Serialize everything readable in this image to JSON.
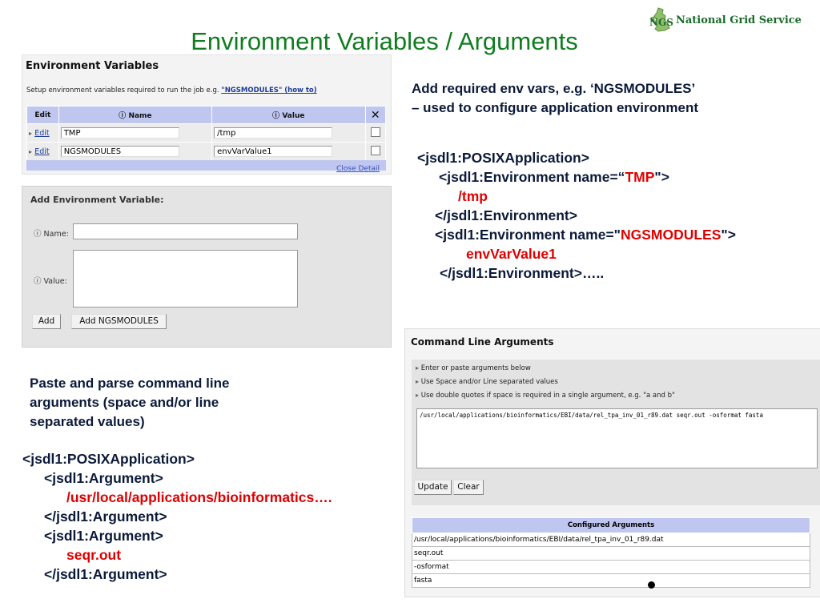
{
  "slide": {
    "title": "Environment Variables / Arguments",
    "logo_text": "National Grid Service",
    "logo_mark": "NGS"
  },
  "env_panel": {
    "heading": "Environment Variables",
    "description": "Setup environment variables required to run the job e.g.",
    "howto_link": "\"NGSMODULES\" (how to)",
    "columns": [
      "Edit",
      "Name",
      "Value"
    ],
    "rows": [
      {
        "edit": "Edit",
        "name": "TMP",
        "value": "/tmp"
      },
      {
        "edit": "Edit",
        "name": "NGSMODULES",
        "value": "envVarValue1"
      }
    ],
    "close_link": "Close Detail"
  },
  "add_panel": {
    "heading": "Add Environment Variable:",
    "name_label": "Name:",
    "value_label": "Value:",
    "add_button": "Add",
    "add_ngsmodules_button": "Add NGSMODULES"
  },
  "env_note": {
    "line1": "Add required env vars, e.g. ‘NGSMODULES’",
    "line2": "– used to configure application environment"
  },
  "env_code": {
    "l1": "<jsdl1:POSIXApplication>",
    "l2a": "<jsdl1:Environment name=“",
    "l2b": "TMP",
    "l2c": "\">",
    "l3": "/tmp",
    "l4": "</jsdl1:Environment>",
    "l5a": "<jsdl1:Environment name=\"",
    "l5b": "NGSMODULES",
    "l5c": "\">",
    "l6": "envVarValue1",
    "l7": "</jsdl1:Environment>….."
  },
  "cmd_panel": {
    "heading": "Command Line Arguments",
    "bullets": [
      "Enter or paste arguments below",
      "Use Space and/or Line separated values",
      "Use double quotes if space is required in a single argument, e.g. \"a and b\""
    ],
    "args_value": "/usr/local/applications/bioinformatics/EBI/data/rel_tpa_inv_01_r89.dat seqr.out -osformat fasta",
    "update_button": "Update",
    "clear_button": "Clear",
    "configured_header": "Configured Arguments",
    "configured": [
      "/usr/local/applications/bioinformatics/EBI/data/rel_tpa_inv_01_r89.dat",
      "seqr.out",
      "-osformat",
      "fasta"
    ]
  },
  "args_note": {
    "line1": "Paste and parse command line",
    "line2": "arguments (space and/or line",
    "line3": "separated values)"
  },
  "args_code": {
    "l1": "<jsdl1:POSIXApplication>",
    "l2": "<jsdl1:Argument>",
    "l3": "/usr/local/applications/bioinformatics….",
    "l4": "</jsdl1:Argument>",
    "l5": "<jsdl1:Argument>",
    "l6": "seqr.out",
    "l7": "</jsdl1:Argument>"
  },
  "colors": {
    "title_green": "#0f7d1f",
    "code_red": "#e00000",
    "header_blue": "#bfc7f0",
    "text_navy": "#0c1a3a"
  }
}
